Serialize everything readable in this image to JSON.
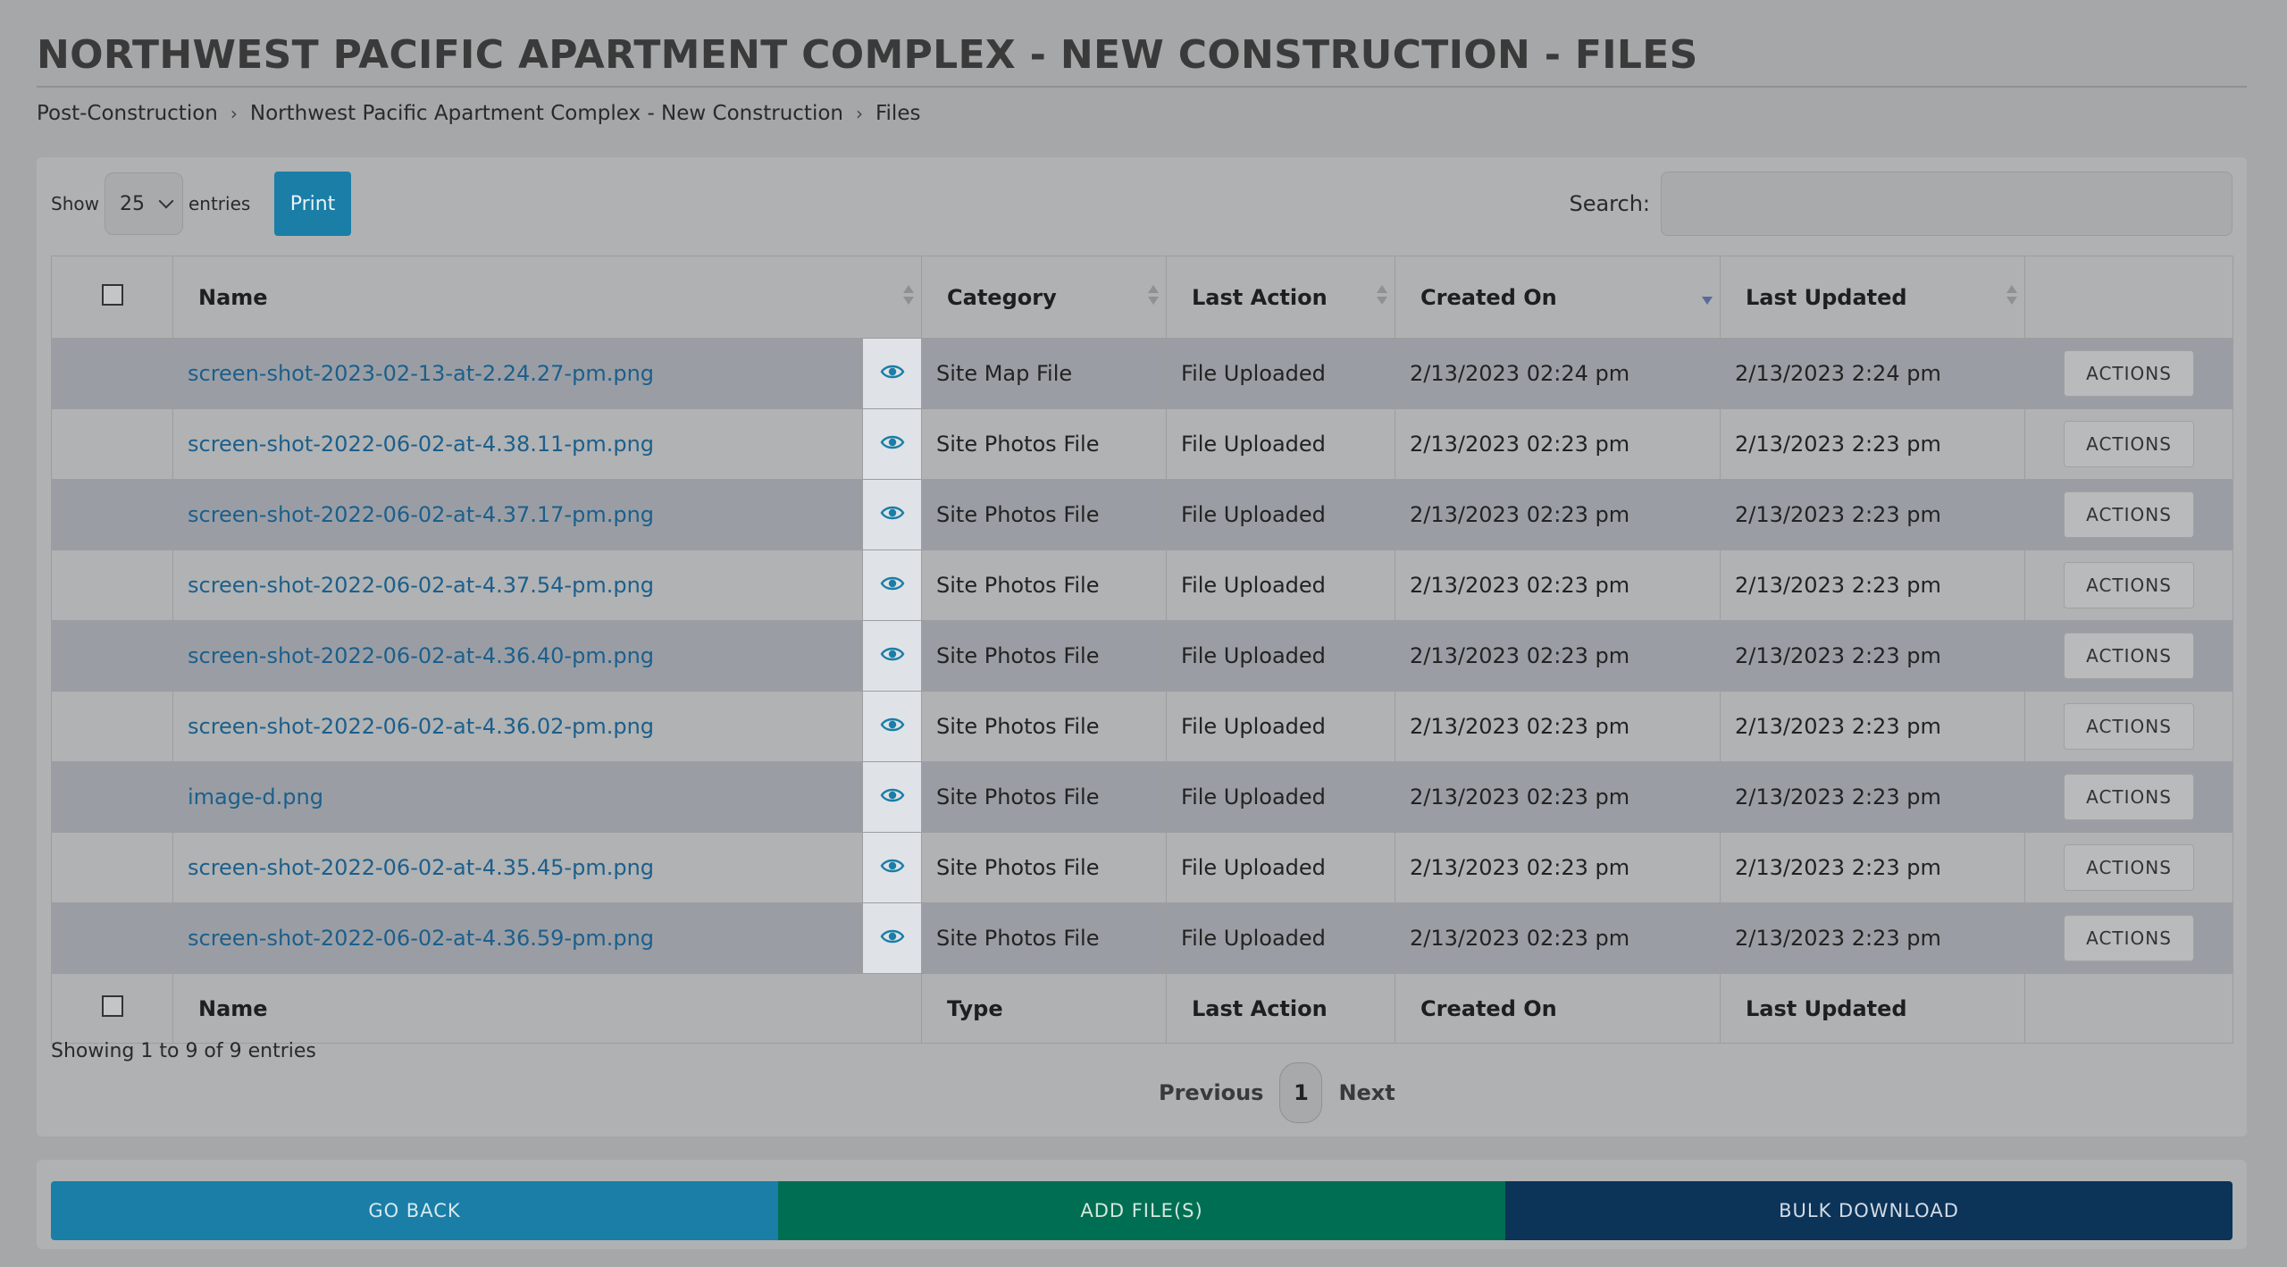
{
  "page": {
    "title": "NORTHWEST PACIFIC APARTMENT COMPLEX - NEW CONSTRUCTION - FILES",
    "breadcrumb": [
      "Post-Construction",
      "Northwest Pacific Apartment Complex - New Construction",
      "Files"
    ],
    "breadcrumb_sep": "›"
  },
  "controls": {
    "show_label": "Show",
    "entries_value": "25",
    "entries_label": "entries",
    "print_label": "Print",
    "search_label": "Search:",
    "search_value": ""
  },
  "table": {
    "headers": [
      "Name",
      "Category",
      "Last Action",
      "Created On",
      "Last Updated"
    ],
    "footers": [
      "Name",
      "Type",
      "Last Action",
      "Created On",
      "Last Updated"
    ],
    "rows": [
      {
        "name": "screen-shot-2023-02-13-at-2.24.27-pm.png",
        "category": "Site Map File",
        "last_action": "File Uploaded",
        "created_on": "2/13/2023 02:24 pm",
        "last_updated": "2/13/2023 2:24 pm",
        "actions": "ACTIONS"
      },
      {
        "name": "screen-shot-2022-06-02-at-4.38.11-pm.png",
        "category": "Site Photos File",
        "last_action": "File Uploaded",
        "created_on": "2/13/2023 02:23 pm",
        "last_updated": "2/13/2023 2:23 pm",
        "actions": "ACTIONS"
      },
      {
        "name": "screen-shot-2022-06-02-at-4.37.17-pm.png",
        "category": "Site Photos File",
        "last_action": "File Uploaded",
        "created_on": "2/13/2023 02:23 pm",
        "last_updated": "2/13/2023 2:23 pm",
        "actions": "ACTIONS"
      },
      {
        "name": "screen-shot-2022-06-02-at-4.37.54-pm.png",
        "category": "Site Photos File",
        "last_action": "File Uploaded",
        "created_on": "2/13/2023 02:23 pm",
        "last_updated": "2/13/2023 2:23 pm",
        "actions": "ACTIONS"
      },
      {
        "name": "screen-shot-2022-06-02-at-4.36.40-pm.png",
        "category": "Site Photos File",
        "last_action": "File Uploaded",
        "created_on": "2/13/2023 02:23 pm",
        "last_updated": "2/13/2023 2:23 pm",
        "actions": "ACTIONS"
      },
      {
        "name": "screen-shot-2022-06-02-at-4.36.02-pm.png",
        "category": "Site Photos File",
        "last_action": "File Uploaded",
        "created_on": "2/13/2023 02:23 pm",
        "last_updated": "2/13/2023 2:23 pm",
        "actions": "ACTIONS"
      },
      {
        "name": "image-d.png",
        "category": "Site Photos File",
        "last_action": "File Uploaded",
        "created_on": "2/13/2023 02:23 pm",
        "last_updated": "2/13/2023 2:23 pm",
        "actions": "ACTIONS"
      },
      {
        "name": "screen-shot-2022-06-02-at-4.35.45-pm.png",
        "category": "Site Photos File",
        "last_action": "File Uploaded",
        "created_on": "2/13/2023 02:23 pm",
        "last_updated": "2/13/2023 2:23 pm",
        "actions": "ACTIONS"
      },
      {
        "name": "screen-shot-2022-06-02-at-4.36.59-pm.png",
        "category": "Site Photos File",
        "last_action": "File Uploaded",
        "created_on": "2/13/2023 02:23 pm",
        "last_updated": "2/13/2023 2:23 pm",
        "actions": "ACTIONS"
      }
    ],
    "sorted_column": "Created On",
    "sort_direction": "descending"
  },
  "pagination": {
    "info": "Showing 1 to 9 of 9 entries",
    "previous": "Previous",
    "current_page": "1",
    "next": "Next"
  },
  "footer_buttons": {
    "go_back": "GO BACK",
    "add_files": "ADD FILE(S)",
    "bulk_download": "BULK DOWNLOAD"
  },
  "colors": {
    "primary": "#1a7ea7",
    "success": "#006e52",
    "dark": "#0c3358",
    "link": "#1b5f8c",
    "eye_icon": "#1a7ea7"
  },
  "icons": {
    "view": "eye-icon",
    "sort": "sort-icon",
    "dropdown": "chevron-down-icon",
    "breadcrumb_separator": "chevron-right-icon"
  }
}
